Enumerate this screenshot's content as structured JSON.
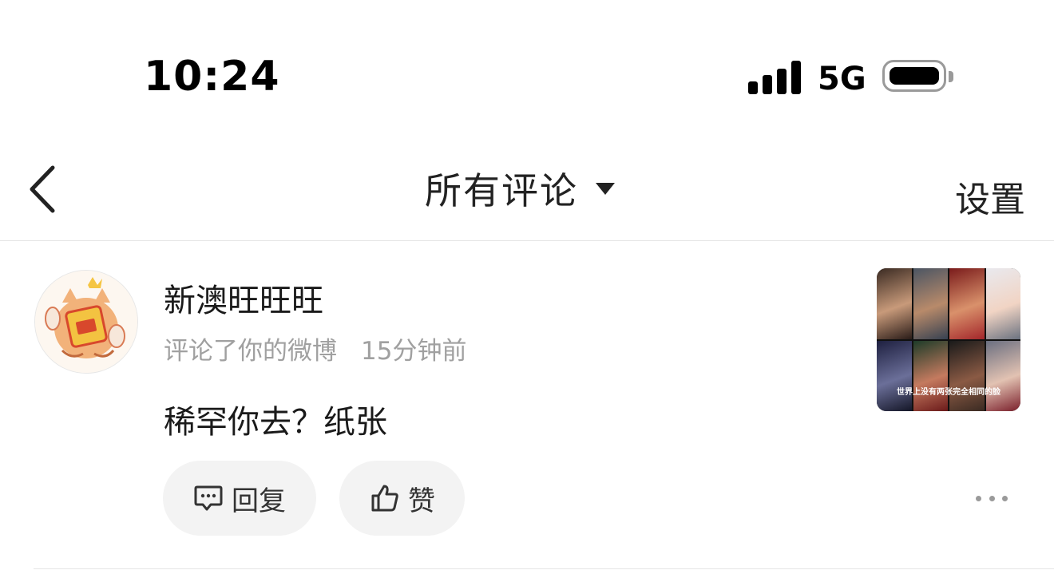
{
  "status_bar": {
    "time": "10:24",
    "network": "5G"
  },
  "nav": {
    "title": "所有评论",
    "settings_label": "设置"
  },
  "comment": {
    "username": "新澳旺旺旺",
    "action": "评论了你的微博",
    "time_ago": "15分钟前",
    "text": "稀罕你去？纸张",
    "thumbnail_caption": "世界上没有两张完全相同的脸",
    "reply_label": "回复",
    "like_label": "赞"
  },
  "colors": {
    "text_primary": "#1a1a1a",
    "text_secondary": "#a0a0a0",
    "pill_bg": "#f3f3f3",
    "divider": "#e4e4e4"
  },
  "icons": [
    "back-chevron-icon",
    "dropdown-caret-icon",
    "signal-icon",
    "battery-icon",
    "comment-bubble-icon",
    "thumbs-up-icon",
    "more-dots-icon"
  ]
}
